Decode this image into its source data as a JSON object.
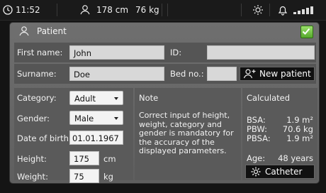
{
  "status_bar": {
    "time": "11:52",
    "height": "178 cm",
    "weight": "76 kg",
    "icons": [
      "clock-icon",
      "person-icon",
      "brightness-icon",
      "bell-icon",
      "signal-icon"
    ]
  },
  "panel": {
    "title": "Patient",
    "confirm_icon": "checkmark-icon"
  },
  "form": {
    "first_name_label": "First name:",
    "first_name_value": "John",
    "id_label": "ID:",
    "id_value": "",
    "surname_label": "Surname:",
    "surname_value": "Doe",
    "bed_label": "Bed no.:",
    "bed_value": "",
    "new_patient_label": "New patient",
    "category_label": "Category:",
    "category_value": "Adult",
    "gender_label": "Gender:",
    "gender_value": "Male",
    "dob_label": "Date of birth:",
    "dob_value": "01.01.1967",
    "height_label": "Height:",
    "height_value": "175",
    "height_unit": "cm",
    "weight_label": "Weight:",
    "weight_value": "75",
    "weight_unit": "kg"
  },
  "note": {
    "title": "Note",
    "text": "Correct input of height, weight, category and gender is mandatory for the accuracy of the displayed parameters."
  },
  "calculated": {
    "title": "Calculated",
    "bsa_label": "BSA:",
    "bsa_value": "1.9 m²",
    "pbw_label": "PBW:",
    "pbw_value": "70.6 kg",
    "pbsa_label": "PBSA:",
    "pbsa_value": "1.9 m²",
    "age_label": "Age:",
    "age_value": "48 years",
    "catheter_label": "Catheter"
  }
}
